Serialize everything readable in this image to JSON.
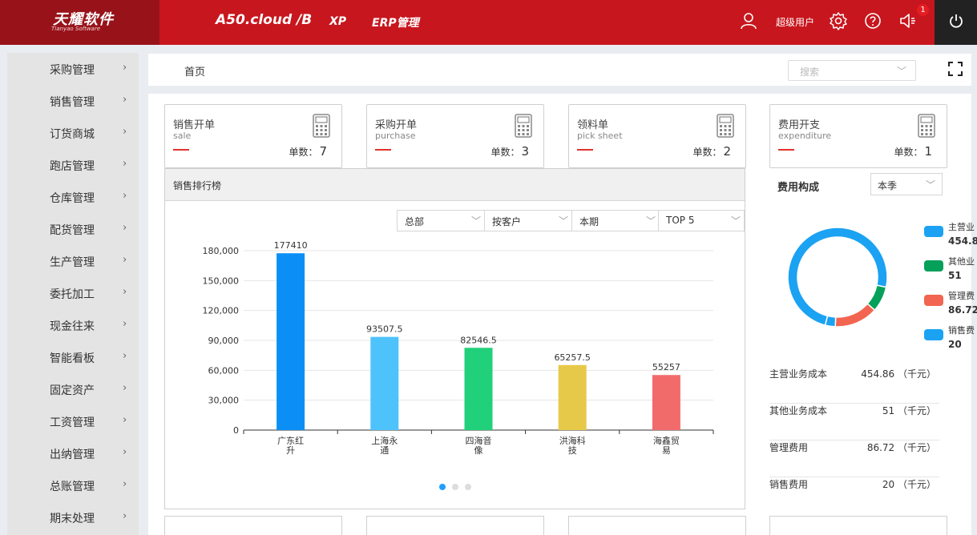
{
  "header": {
    "logo_text": "天耀软件",
    "logo_sub": "Tianyao Software",
    "nav": [
      "A50.cloud /B",
      "XP",
      "ERP管理"
    ],
    "user_label": "超级用户",
    "notification_count": "1",
    "icons": [
      "user-icon",
      "gear-icon",
      "help-icon",
      "speaker-icon",
      "power-icon"
    ]
  },
  "sidebar": {
    "items": [
      {
        "label": "采购管理"
      },
      {
        "label": "销售管理"
      },
      {
        "label": "订货商城"
      },
      {
        "label": "跑店管理"
      },
      {
        "label": "仓库管理"
      },
      {
        "label": "配货管理"
      },
      {
        "label": "生产管理"
      },
      {
        "label": "委托加工"
      },
      {
        "label": "现金往来"
      },
      {
        "label": "智能看板"
      },
      {
        "label": "固定资产"
      },
      {
        "label": "工资管理"
      },
      {
        "label": "出纳管理"
      },
      {
        "label": "总账管理"
      },
      {
        "label": "期末处理"
      }
    ],
    "chevron": "›"
  },
  "breadcrumb": {
    "label": "首页"
  },
  "search": {
    "placeholder": "搜索"
  },
  "cards": [
    {
      "title": "销售开单",
      "sub": "sale",
      "count_label": "单数：",
      "count": "7"
    },
    {
      "title": "采购开单",
      "sub": "purchase",
      "count_label": "单数：",
      "count": "3"
    },
    {
      "title": "领料单",
      "sub": "pick sheet",
      "count_label": "单数：",
      "count": "2"
    },
    {
      "title": "费用开支",
      "sub": "expenditure",
      "count_label": "单数：",
      "count": "1"
    }
  ],
  "rank": {
    "title": "销售排行榜",
    "filters": [
      "总部",
      "按客户",
      "本期",
      "TOP 5"
    ]
  },
  "chart_data": {
    "type": "bar",
    "categories": [
      "广东红升",
      "上海永通",
      "四海音像",
      "洪海科技",
      "海鑫贸易"
    ],
    "category_lines": [
      [
        "广东红",
        "升"
      ],
      [
        "上海永",
        "通"
      ],
      [
        "四海音",
        "像"
      ],
      [
        "洪海科",
        "技"
      ],
      [
        "海鑫贸",
        "易"
      ]
    ],
    "values": [
      177410,
      93507.5,
      82546.5,
      65257.5,
      55257
    ],
    "value_labels": [
      "177410",
      "93507.5",
      "82546.5",
      "65257.5",
      "55257"
    ],
    "colors": [
      "#0b8ff5",
      "#4ec3fb",
      "#21d07a",
      "#e7c94a",
      "#f26b6b"
    ],
    "ylim": [
      0,
      180000
    ],
    "yticks": [
      0,
      30000,
      60000,
      90000,
      120000,
      150000,
      180000
    ],
    "ytick_labels": [
      "0",
      "30,000",
      "60,000",
      "90,000",
      "120,000",
      "150,000",
      "180,000"
    ],
    "grid": true,
    "title": "",
    "xlabel": "",
    "ylabel": ""
  },
  "pager": {
    "count": 3,
    "active": 0,
    "active_color": "#1e9fff"
  },
  "cost": {
    "title": "费用构成",
    "period": "本季",
    "donut": [
      {
        "name": "主营业务成本",
        "value": 454.86,
        "color": "#1ba2f2"
      },
      {
        "name": "其他业务成本",
        "value": 51,
        "color": "#05a05a"
      },
      {
        "name": "管理费用",
        "value": 86.72,
        "color": "#f26550"
      },
      {
        "name": "销售费用",
        "value": 20,
        "color": "#1ba2f2"
      }
    ],
    "legend": [
      {
        "name": "主营业",
        "value": "454.8",
        "color": "#1ba2f2"
      },
      {
        "name": "其他业",
        "value": "51",
        "color": "#05a05a"
      },
      {
        "name": "管理费",
        "value": "86.72",
        "color": "#f26550"
      },
      {
        "name": "销售费",
        "value": "20",
        "color": "#1ba2f2"
      }
    ],
    "rows": [
      {
        "name": "主营业务成本",
        "amount": "454.86 （千元）"
      },
      {
        "name": "其他业务成本",
        "amount": "51 （千元）"
      },
      {
        "name": "管理费用",
        "amount": "86.72 （千元）"
      },
      {
        "name": "销售费用",
        "amount": "20 （千元）"
      }
    ]
  },
  "colors": {
    "brand": "#c8161e",
    "brand_dark": "#98121a",
    "accent": "#e0332d"
  }
}
